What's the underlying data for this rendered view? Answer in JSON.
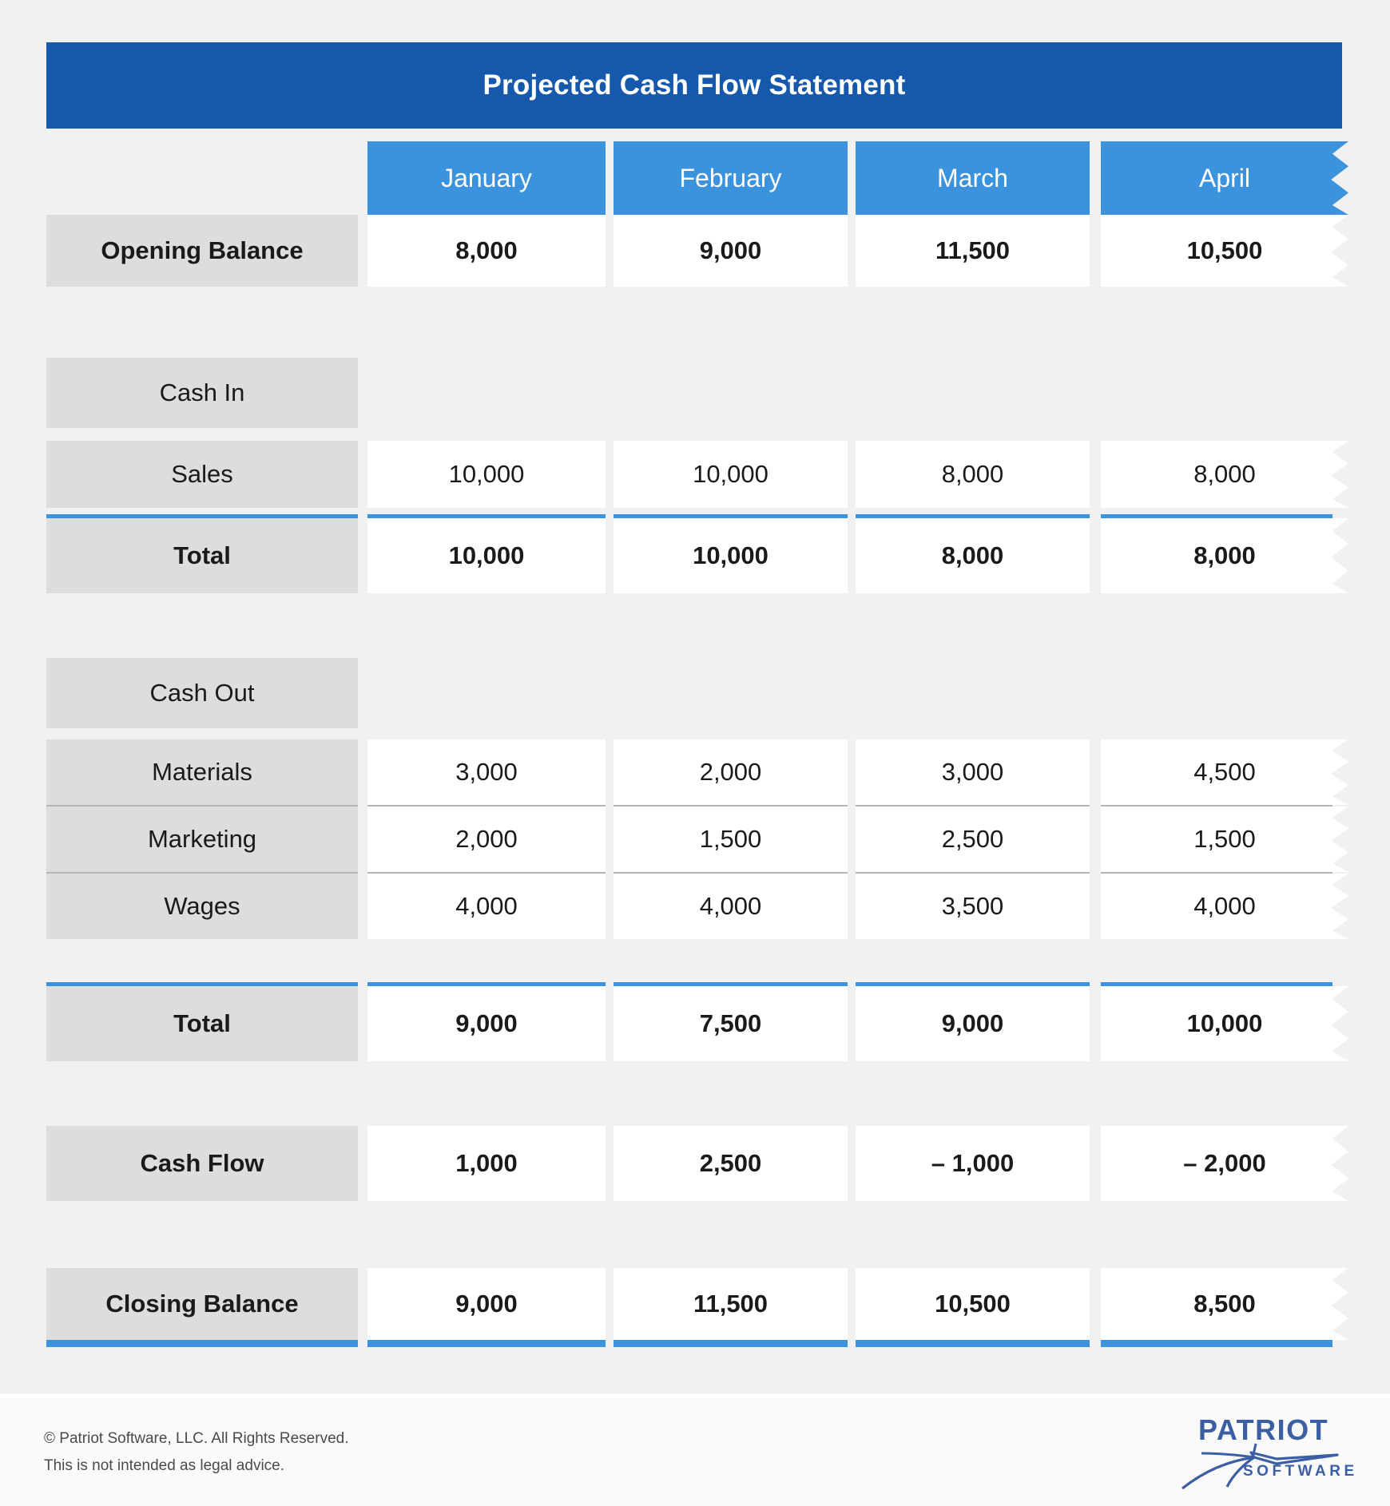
{
  "header": {
    "title": "Projected Cash Flow Statement",
    "accent_dark": "#1659AC",
    "accent_light": "#3B92DD"
  },
  "chart_data": {
    "type": "table",
    "title": "Projected Cash Flow Statement",
    "categories": [
      "January",
      "February",
      "March",
      "April"
    ],
    "row_label_header": "",
    "rows": [
      {
        "label": "Opening Balance",
        "style": "bold",
        "values": [
          "8,000",
          "9,000",
          "11,500",
          "10,500"
        ]
      },
      {
        "label": "Cash In",
        "style": "section",
        "values": [
          "",
          "",
          "",
          ""
        ]
      },
      {
        "label": "Sales",
        "style": "normal",
        "values": [
          "10,000",
          "10,000",
          "8,000",
          "8,000"
        ]
      },
      {
        "label": "Total",
        "style": "bold",
        "values": [
          "10,000",
          "10,000",
          "8,000",
          "8,000"
        ]
      },
      {
        "label": "Cash Out",
        "style": "section",
        "values": [
          "",
          "",
          "",
          ""
        ]
      },
      {
        "label": "Materials",
        "style": "normal",
        "values": [
          "3,000",
          "2,000",
          "3,000",
          "4,500"
        ]
      },
      {
        "label": "Marketing",
        "style": "normal",
        "values": [
          "2,000",
          "1,500",
          "2,500",
          "1,500"
        ]
      },
      {
        "label": "Wages",
        "style": "normal",
        "values": [
          "4,000",
          "4,000",
          "3,500",
          "4,000"
        ]
      },
      {
        "label": "Total",
        "style": "bold",
        "values": [
          "9,000",
          "7,500",
          "9,000",
          "10,000"
        ]
      },
      {
        "label": "Cash Flow",
        "style": "bold",
        "values": [
          "1,000",
          "2,500",
          "– 1,000",
          "– 2,000"
        ]
      },
      {
        "label": "Closing Balance",
        "style": "bold",
        "values": [
          "9,000",
          "11,500",
          "10,500",
          "8,500"
        ]
      }
    ]
  },
  "footer": {
    "copyright_line1": "© Patriot Software, LLC. All Rights Reserved.",
    "copyright_line2": "This is not intended as legal advice.",
    "logo_word": "PATRIOT",
    "logo_sub": "SOFTWARE"
  }
}
